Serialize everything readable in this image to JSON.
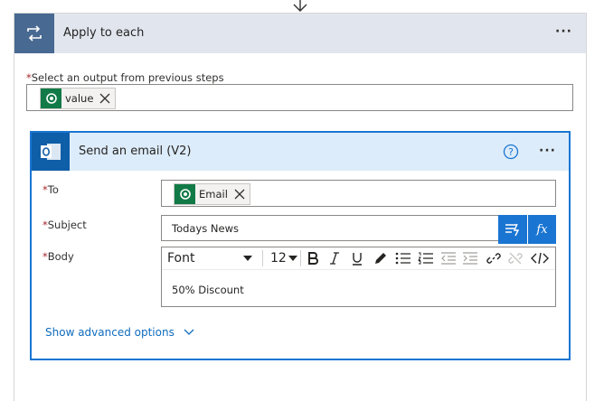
{
  "outer_action": {
    "title": "Apply to each",
    "icon": "loop-icon",
    "menu_icon": "more-options-icon"
  },
  "select_output": {
    "label": "Select an output from previous steps",
    "required_marker": "*",
    "token": {
      "label": "value",
      "icon": "dataverse-icon"
    }
  },
  "email_action": {
    "title": "Send an email (V2)",
    "icon": "outlook-icon",
    "help_icon": "help-icon",
    "menu_icon": "more-options-icon",
    "fields": {
      "to": {
        "label": "To",
        "required_marker": "*",
        "token": {
          "label": "Email",
          "icon": "dataverse-icon"
        }
      },
      "subject": {
        "label": "Subject",
        "required_marker": "*",
        "value": "Todays News"
      },
      "body": {
        "label": "Body",
        "required_marker": "*",
        "value": "50% Discount"
      }
    },
    "editor_toolbar": {
      "font": "Font",
      "size": "12",
      "buttons": [
        "bold-icon",
        "italic-icon",
        "underline-icon",
        "highlight-icon",
        "bullet-list-icon",
        "numbered-list-icon",
        "outdent-icon",
        "indent-icon",
        "link-icon",
        "unlink-icon",
        "code-view-icon"
      ]
    },
    "subject_side_buttons": {
      "dynamic_content": "dynamic-content-icon",
      "expression": "fx"
    },
    "advanced_link": "Show advanced options"
  },
  "colors": {
    "loop_tile": "#486991",
    "outlook_tile": "#0f5ea8",
    "accent": "#1a75d2",
    "dataverse": "#127a47",
    "required": "#a4262c"
  }
}
